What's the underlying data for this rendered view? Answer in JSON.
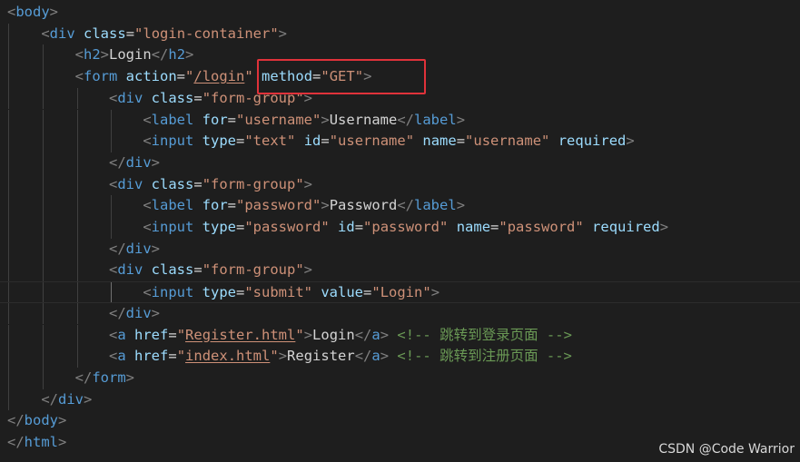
{
  "editor": {
    "lines": [
      {
        "indent": 0,
        "tokens": [
          [
            "punc",
            "<"
          ],
          [
            "tag",
            "body"
          ],
          [
            "punc",
            ">"
          ]
        ]
      },
      {
        "indent": 1,
        "tokens": [
          [
            "punc",
            "<"
          ],
          [
            "tag",
            "div"
          ],
          [
            "plain",
            " "
          ],
          [
            "attr",
            "class"
          ],
          [
            "eq",
            "="
          ],
          [
            "str",
            "\"login-container\""
          ],
          [
            "punc",
            ">"
          ]
        ]
      },
      {
        "indent": 2,
        "tokens": [
          [
            "punc",
            "<"
          ],
          [
            "tag",
            "h2"
          ],
          [
            "punc",
            ">"
          ],
          [
            "plain",
            "Login"
          ],
          [
            "punc",
            "</"
          ],
          [
            "tag",
            "h2"
          ],
          [
            "punc",
            ">"
          ]
        ]
      },
      {
        "indent": 2,
        "tokens": [
          [
            "punc",
            "<"
          ],
          [
            "tag",
            "form"
          ],
          [
            "plain",
            " "
          ],
          [
            "attr",
            "action"
          ],
          [
            "eq",
            "="
          ],
          [
            "str",
            "\""
          ],
          [
            "strul",
            "/login"
          ],
          [
            "str",
            "\""
          ],
          [
            "plain",
            " "
          ],
          [
            "attr",
            "method"
          ],
          [
            "eq",
            "="
          ],
          [
            "str",
            "\"GET\""
          ],
          [
            "punc",
            ">"
          ]
        ]
      },
      {
        "indent": 3,
        "tokens": [
          [
            "punc",
            "<"
          ],
          [
            "tag",
            "div"
          ],
          [
            "plain",
            " "
          ],
          [
            "attr",
            "class"
          ],
          [
            "eq",
            "="
          ],
          [
            "str",
            "\"form-group\""
          ],
          [
            "punc",
            ">"
          ]
        ]
      },
      {
        "indent": 4,
        "tokens": [
          [
            "punc",
            "<"
          ],
          [
            "tag",
            "label"
          ],
          [
            "plain",
            " "
          ],
          [
            "attr",
            "for"
          ],
          [
            "eq",
            "="
          ],
          [
            "str",
            "\"username\""
          ],
          [
            "punc",
            ">"
          ],
          [
            "plain",
            "Username"
          ],
          [
            "punc",
            "</"
          ],
          [
            "tag",
            "label"
          ],
          [
            "punc",
            ">"
          ]
        ]
      },
      {
        "indent": 4,
        "tokens": [
          [
            "punc",
            "<"
          ],
          [
            "tag",
            "input"
          ],
          [
            "plain",
            " "
          ],
          [
            "attr",
            "type"
          ],
          [
            "eq",
            "="
          ],
          [
            "str",
            "\"text\""
          ],
          [
            "plain",
            " "
          ],
          [
            "attr",
            "id"
          ],
          [
            "eq",
            "="
          ],
          [
            "str",
            "\"username\""
          ],
          [
            "plain",
            " "
          ],
          [
            "attr",
            "name"
          ],
          [
            "eq",
            "="
          ],
          [
            "str",
            "\"username\""
          ],
          [
            "plain",
            " "
          ],
          [
            "attr",
            "required"
          ],
          [
            "punc",
            ">"
          ]
        ]
      },
      {
        "indent": 3,
        "tokens": [
          [
            "punc",
            "</"
          ],
          [
            "tag",
            "div"
          ],
          [
            "punc",
            ">"
          ]
        ]
      },
      {
        "indent": 3,
        "tokens": [
          [
            "punc",
            "<"
          ],
          [
            "tag",
            "div"
          ],
          [
            "plain",
            " "
          ],
          [
            "attr",
            "class"
          ],
          [
            "eq",
            "="
          ],
          [
            "str",
            "\"form-group\""
          ],
          [
            "punc",
            ">"
          ]
        ]
      },
      {
        "indent": 4,
        "tokens": [
          [
            "punc",
            "<"
          ],
          [
            "tag",
            "label"
          ],
          [
            "plain",
            " "
          ],
          [
            "attr",
            "for"
          ],
          [
            "eq",
            "="
          ],
          [
            "str",
            "\"password\""
          ],
          [
            "punc",
            ">"
          ],
          [
            "plain",
            "Password"
          ],
          [
            "punc",
            "</"
          ],
          [
            "tag",
            "label"
          ],
          [
            "punc",
            ">"
          ]
        ]
      },
      {
        "indent": 4,
        "tokens": [
          [
            "punc",
            "<"
          ],
          [
            "tag",
            "input"
          ],
          [
            "plain",
            " "
          ],
          [
            "attr",
            "type"
          ],
          [
            "eq",
            "="
          ],
          [
            "str",
            "\"password\""
          ],
          [
            "plain",
            " "
          ],
          [
            "attr",
            "id"
          ],
          [
            "eq",
            "="
          ],
          [
            "str",
            "\"password\""
          ],
          [
            "plain",
            " "
          ],
          [
            "attr",
            "name"
          ],
          [
            "eq",
            "="
          ],
          [
            "str",
            "\"password\""
          ],
          [
            "plain",
            " "
          ],
          [
            "attr",
            "required"
          ],
          [
            "punc",
            ">"
          ]
        ]
      },
      {
        "indent": 3,
        "tokens": [
          [
            "punc",
            "</"
          ],
          [
            "tag",
            "div"
          ],
          [
            "punc",
            ">"
          ]
        ]
      },
      {
        "indent": 3,
        "tokens": [
          [
            "punc",
            "<"
          ],
          [
            "tag",
            "div"
          ],
          [
            "plain",
            " "
          ],
          [
            "attr",
            "class"
          ],
          [
            "eq",
            "="
          ],
          [
            "str",
            "\"form-group\""
          ],
          [
            "punc",
            ">"
          ]
        ]
      },
      {
        "indent": 4,
        "current": true,
        "tokens": [
          [
            "punc",
            "<"
          ],
          [
            "tag",
            "input"
          ],
          [
            "plain",
            " "
          ],
          [
            "attr",
            "type"
          ],
          [
            "eq",
            "="
          ],
          [
            "str",
            "\"submit\""
          ],
          [
            "plain",
            " "
          ],
          [
            "attr",
            "value"
          ],
          [
            "eq",
            "="
          ],
          [
            "str",
            "\"Login\""
          ],
          [
            "punc",
            ">"
          ]
        ]
      },
      {
        "indent": 3,
        "tokens": [
          [
            "punc",
            "</"
          ],
          [
            "tag",
            "div"
          ],
          [
            "punc",
            ">"
          ]
        ]
      },
      {
        "indent": 3,
        "tokens": [
          [
            "punc",
            "<"
          ],
          [
            "tag",
            "a"
          ],
          [
            "plain",
            " "
          ],
          [
            "attr",
            "href"
          ],
          [
            "eq",
            "="
          ],
          [
            "str",
            "\""
          ],
          [
            "strul",
            "Register.html"
          ],
          [
            "str",
            "\""
          ],
          [
            "punc",
            ">"
          ],
          [
            "plain",
            "Login"
          ],
          [
            "punc",
            "</"
          ],
          [
            "tag",
            "a"
          ],
          [
            "punc",
            ">"
          ],
          [
            "plain",
            " "
          ],
          [
            "cmt",
            "<!-- 跳转到登录页面 -->"
          ]
        ]
      },
      {
        "indent": 3,
        "tokens": [
          [
            "punc",
            "<"
          ],
          [
            "tag",
            "a"
          ],
          [
            "plain",
            " "
          ],
          [
            "attr",
            "href"
          ],
          [
            "eq",
            "="
          ],
          [
            "str",
            "\""
          ],
          [
            "strul",
            "index.html"
          ],
          [
            "str",
            "\""
          ],
          [
            "punc",
            ">"
          ],
          [
            "plain",
            "Register"
          ],
          [
            "punc",
            "</"
          ],
          [
            "tag",
            "a"
          ],
          [
            "punc",
            ">"
          ],
          [
            "plain",
            " "
          ],
          [
            "cmt",
            "<!-- 跳转到注册页面 -->"
          ]
        ]
      },
      {
        "indent": 2,
        "tokens": [
          [
            "punc",
            "</"
          ],
          [
            "tag",
            "form"
          ],
          [
            "punc",
            ">"
          ]
        ]
      },
      {
        "indent": 1,
        "tokens": [
          [
            "punc",
            "</"
          ],
          [
            "tag",
            "div"
          ],
          [
            "punc",
            ">"
          ]
        ]
      },
      {
        "indent": 0,
        "tokens": [
          [
            "punc",
            "</"
          ],
          [
            "tag",
            "body"
          ],
          [
            "punc",
            ">"
          ]
        ]
      },
      {
        "indent": 0,
        "tokens": [
          [
            "punc",
            "</"
          ],
          [
            "tag",
            "html"
          ],
          [
            "punc",
            ">"
          ]
        ]
      }
    ]
  },
  "highlight": {
    "label": "method=\"GET\" highlight",
    "color": "#e0323a"
  },
  "watermark": "CSDN @Code Warrior"
}
